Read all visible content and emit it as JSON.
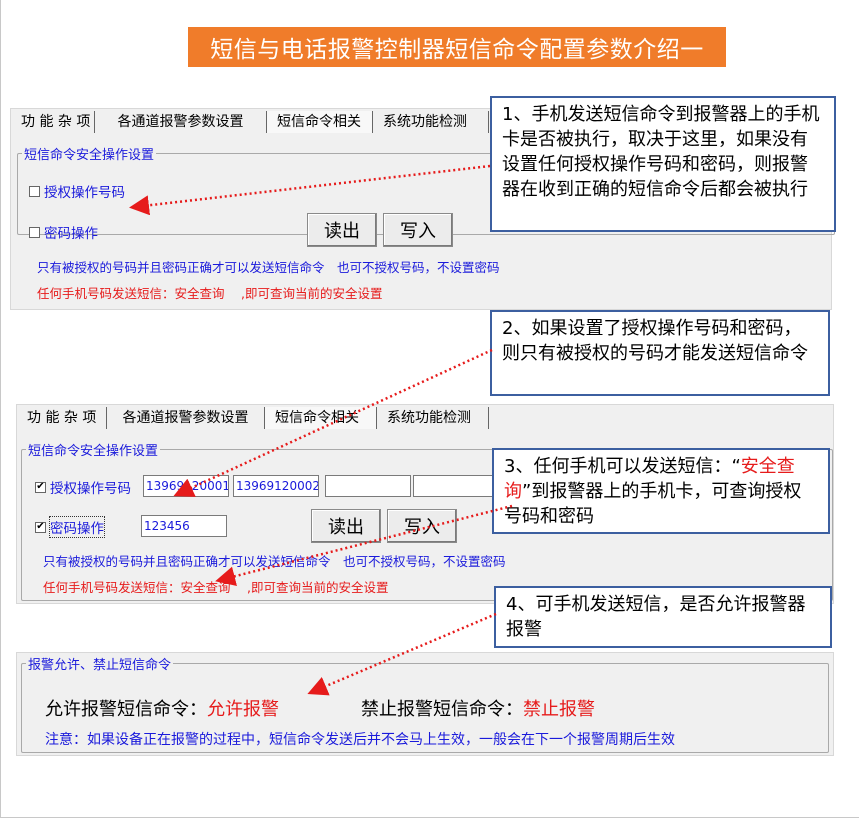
{
  "title": "短信与电话报警控制器短信命令配置参数介绍一",
  "tabs": [
    "功 能 杂 项",
    "各通道报警参数设置",
    "短信命令相关",
    "系统功能检测"
  ],
  "panel1": {
    "group_title": "短信命令安全操作设置",
    "auth_label": "授权操作号码",
    "password_label": "密码操作",
    "read_button": "读出",
    "write_button": "写入",
    "hint_blue": "只有被授权的号码并且密码正确才可以发送短信命令　也可不授权号码，不设置密码",
    "hint_red": "任何手机号码发送短信：安全查询　 ,即可查询当前的安全设置"
  },
  "panel2": {
    "group_title": "短信命令安全操作设置",
    "auth_label": "授权操作号码",
    "auth_numbers": [
      "13969120001",
      "13969120002",
      "",
      ""
    ],
    "password_label": "密码操作",
    "password_value": "123456",
    "read_button": "读出",
    "write_button": "写入",
    "check_mark": "☑",
    "hint_blue": "只有被授权的号码并且密码正确才可以发送短信命令　也可不授权号码，不设置密码",
    "hint_red": "任何手机号码发送短信：安全查询　 ,即可查询当前的安全设置"
  },
  "panel3": {
    "group_title": "报警允许、禁止短信命令",
    "allow_label": "允许报警短信命令：",
    "allow_value": "允许报警",
    "forbid_label": "禁止报警短信命令：",
    "forbid_value": "禁止报警",
    "note": "注意：如果设备正在报警的过程中，短信命令发送后并不会马上生效，一般会在下一个报警周期后生效"
  },
  "callouts": {
    "c1": "1、手机发送短信命令到报警器上的手机卡是否被执行，取决于这里，如果没有设置任何授权操作号码和密码，则报警器在收到正确的短信命令后都会被执行",
    "c2": "2、如果设置了授权操作号码和密码，则只有被授权的号码才能发送短信命令",
    "c3_pre": "3、任何手机可以发送短信：“",
    "c3_red": "安全查询",
    "c3_post": "”到报警器上的手机卡，可查询授权号码和密码",
    "c4": "4、可手机发送短信，是否允许报警器报警"
  },
  "colors": {
    "banner": "#f07c2a",
    "blue_text": "#1a1adb",
    "red_text": "#e61b1b",
    "arrow": "#e61b1b",
    "callout_border": "#3c5fa0"
  }
}
